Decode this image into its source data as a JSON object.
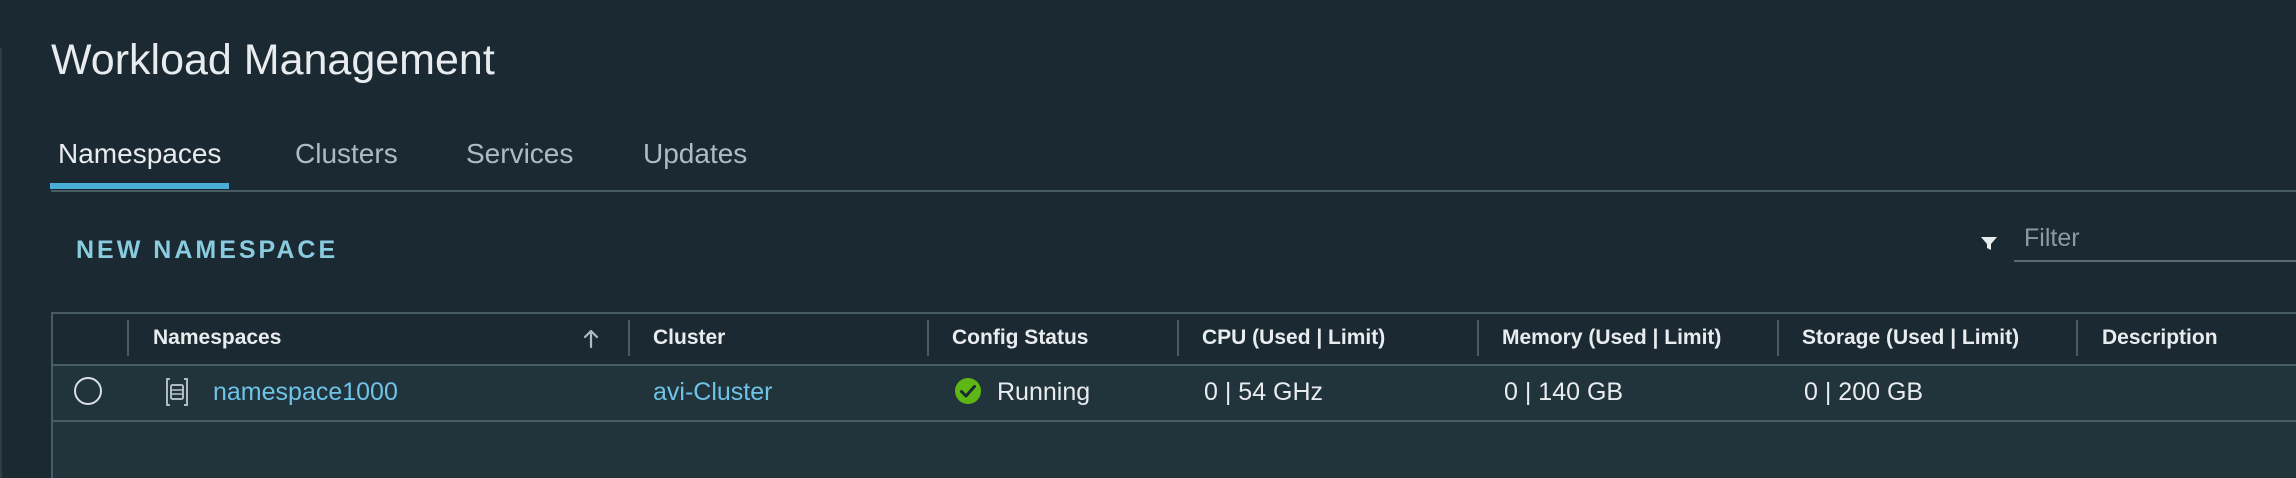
{
  "page": {
    "title": "Workload Management"
  },
  "tabs": [
    {
      "label": "Namespaces",
      "active": true
    },
    {
      "label": "Clusters",
      "active": false
    },
    {
      "label": "Services",
      "active": false
    },
    {
      "label": "Updates",
      "active": false
    }
  ],
  "toolbar": {
    "new_namespace_label": "NEW NAMESPACE",
    "filter_placeholder": "Filter",
    "filter_icon": "filter-icon"
  },
  "table": {
    "columns": [
      {
        "key": "namespace",
        "label": "Namespaces",
        "sort": "ascending"
      },
      {
        "key": "cluster",
        "label": "Cluster"
      },
      {
        "key": "config_status",
        "label": "Config Status"
      },
      {
        "key": "cpu",
        "label": "CPU (Used | Limit)"
      },
      {
        "key": "memory",
        "label": "Memory (Used | Limit)"
      },
      {
        "key": "storage",
        "label": "Storage (Used | Limit)"
      },
      {
        "key": "description",
        "label": "Description"
      }
    ],
    "rows": [
      {
        "namespace": "namespace1000",
        "cluster": "avi-Cluster",
        "config_status": "Running",
        "cpu": "0 | 54 GHz",
        "memory": "0 | 140 GB",
        "storage": "0 | 200 GB",
        "description": ""
      }
    ]
  },
  "colors": {
    "background": "#1b2a32",
    "accent": "#49afd9",
    "link": "#6fc3e8",
    "status_ok": "#5eb715"
  }
}
